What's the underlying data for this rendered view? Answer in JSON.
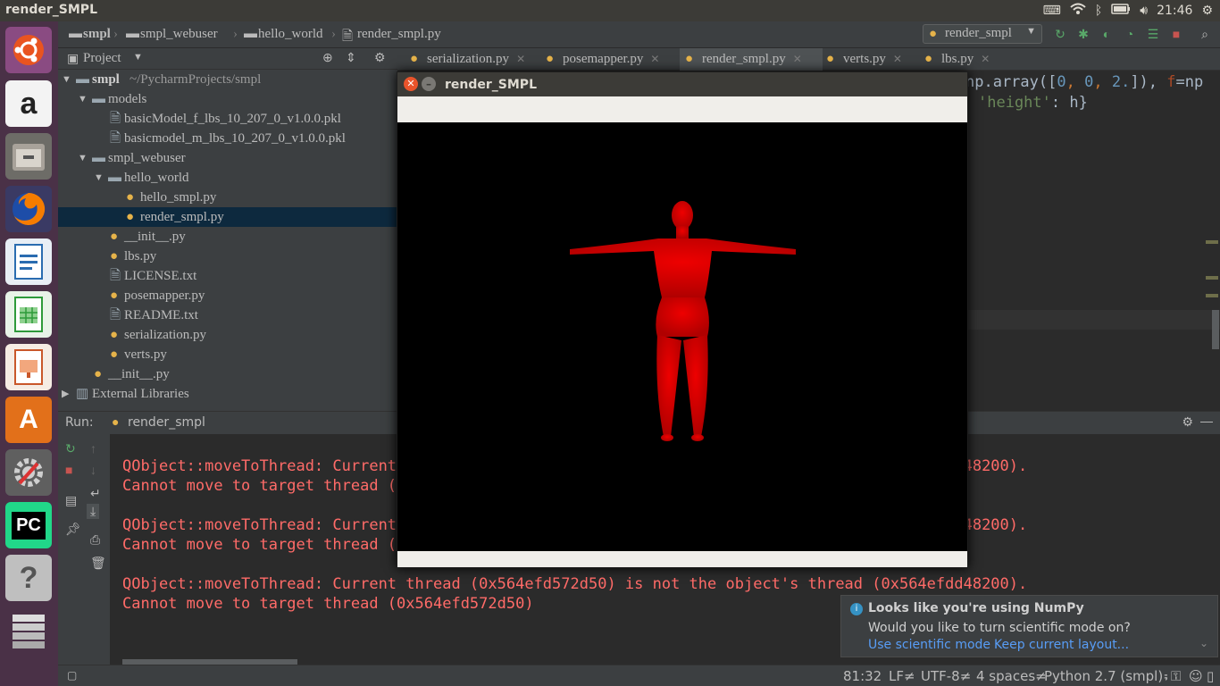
{
  "topbar": {
    "window_title": "render_SMPL",
    "clock": "21:46"
  },
  "navbar": {
    "crumbs": [
      "smpl",
      "smpl_webuser",
      "hello_world",
      "render_smpl.py"
    ],
    "run_config": "render_smpl"
  },
  "project_panel": {
    "title": "Project",
    "items": [
      {
        "label": "smpl",
        "extra": "~/PycharmProjects/smpl"
      },
      {
        "label": "models"
      },
      {
        "label": "basicModel_f_lbs_10_207_0_v1.0.0.pkl"
      },
      {
        "label": "basicmodel_m_lbs_10_207_0_v1.0.0.pkl"
      },
      {
        "label": "smpl_webuser"
      },
      {
        "label": "hello_world"
      },
      {
        "label": "hello_smpl.py"
      },
      {
        "label": "render_smpl.py"
      },
      {
        "label": "__init__.py"
      },
      {
        "label": "lbs.py"
      },
      {
        "label": "LICENSE.txt"
      },
      {
        "label": "posemapper.py"
      },
      {
        "label": "README.txt"
      },
      {
        "label": "serialization.py"
      },
      {
        "label": "verts.py"
      },
      {
        "label": "__init__.py"
      },
      {
        "label": "External Libraries"
      }
    ]
  },
  "tabs": [
    {
      "label": "serialization.py"
    },
    {
      "label": "posemapper.py"
    },
    {
      "label": "render_smpl.py"
    },
    {
      "label": "verts.py"
    },
    {
      "label": "lbs.py"
    }
  ],
  "editor": {
    "line1a": "np.array([",
    "line1b": "0",
    "line1c": ", ",
    "line1d": "0",
    "line1e": ", ",
    "line1f": "2.",
    "line1g": "]), ",
    "line1h": "f",
    "line1i": "=np",
    "line2a": "'height'",
    "line2b": ": h}"
  },
  "run": {
    "label": "Run:",
    "config": "render_smpl",
    "lines": [
      "QObject::moveToThread: Current thread (0x564efd572d50) is not the object's thread (0x564efdd48200).",
      "Cannot move to target thread (0x564efd572d50)",
      "QObject::moveToThread: Current thread (0x564efd572d50) is not the object's thread (0x564efdd48200).",
      "Cannot move to target thread (0x564efd572d50)",
      "QObject::moveToThread: Current thread (0x564efd572d50) is not the object's thread (0x564efdd48200).",
      "Cannot move to target thread (0x564efd572d50)"
    ]
  },
  "notification": {
    "title": "Looks like you're using NumPy",
    "body": "Would you like to turn scientific mode on?",
    "link1": "Use scientific mode",
    "link2": "Keep current layout..."
  },
  "status": {
    "position": "81:32",
    "line_sep": "LF≠",
    "encoding": "UTF-8≠",
    "indent": "4 spaces≠",
    "interpreter": "Python 2.7 (smpl)≠"
  },
  "popup": {
    "title": "render_SMPL"
  },
  "launcher": [
    {
      "name": "ubuntu-dash-icon"
    },
    {
      "name": "amazon-icon",
      "glyph": "a"
    },
    {
      "name": "files-icon"
    },
    {
      "name": "firefox-icon"
    },
    {
      "name": "writer-icon"
    },
    {
      "name": "calc-icon"
    },
    {
      "name": "impress-icon"
    },
    {
      "name": "software-center-icon",
      "glyph": "A"
    },
    {
      "name": "settings-icon"
    },
    {
      "name": "pycharm-icon",
      "glyph": "PC"
    },
    {
      "name": "help-icon",
      "glyph": "?"
    },
    {
      "name": "workspaces-icon"
    }
  ],
  "colors": {
    "console_error": "#ff6b68",
    "selection": "#0d293e",
    "model": "#e00000"
  }
}
